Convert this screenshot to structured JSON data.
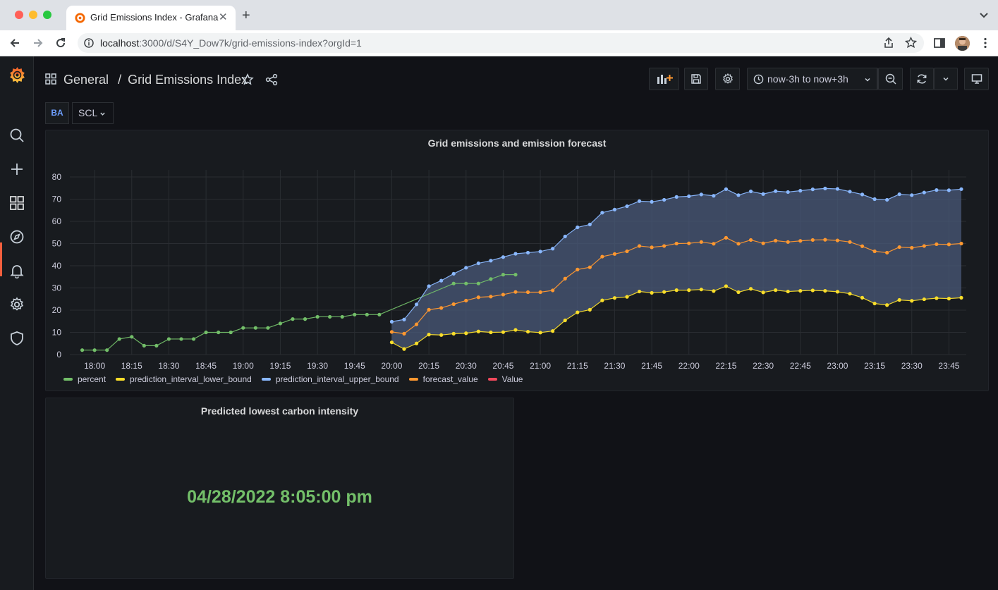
{
  "browser": {
    "tab_title": "Grid Emissions Index - Grafana",
    "url_host": "localhost",
    "url_path": ":3000/d/S4Y_Dow7k/grid-emissions-index?orgId=1"
  },
  "header": {
    "folder": "General",
    "separator": "/",
    "dashboard_title": "Grid Emissions Index",
    "time_range": "now-3h to now+3h"
  },
  "variables": {
    "label": "BA",
    "value": "SCL"
  },
  "panels": {
    "chart_title": "Grid emissions and emission forecast",
    "stat_title": "Predicted lowest carbon intensity",
    "stat_value": "04/28/2022 8:05:00 pm"
  },
  "chart_data": {
    "type": "line",
    "title": "Grid emissions and emission forecast",
    "ylim": [
      0,
      80
    ],
    "yticks": [
      0,
      10,
      20,
      30,
      40,
      50,
      60,
      70,
      80
    ],
    "xticks": [
      "18:00",
      "18:15",
      "18:30",
      "18:45",
      "19:00",
      "19:15",
      "19:30",
      "19:45",
      "20:00",
      "20:15",
      "20:30",
      "20:45",
      "21:00",
      "21:15",
      "21:30",
      "21:45",
      "22:00",
      "22:15",
      "22:30",
      "22:45",
      "23:00",
      "23:15",
      "23:30",
      "23:45"
    ],
    "grid": true,
    "legend_position": "bottom-left",
    "colors": {
      "percent": "#73bf69",
      "prediction_interval_lower_bound": "#fade2a",
      "prediction_interval_upper_bound": "#8ab8ff",
      "forecast_value": "#ff9830",
      "Value": "#f2495c",
      "band_fill": "#4a5a7a"
    },
    "series": [
      {
        "name": "percent",
        "x_start": "17:55",
        "step_min": 5,
        "values": [
          2,
          2,
          2,
          7,
          8,
          4,
          4,
          7,
          7,
          7,
          10,
          10,
          10,
          12,
          12,
          12,
          14,
          16,
          16,
          17,
          17,
          17,
          18,
          18,
          18,
          null,
          null,
          null,
          null,
          null,
          32,
          32,
          32,
          34,
          36,
          36
        ]
      },
      {
        "name": "prediction_interval_lower_bound",
        "x_start": "20:00",
        "step_min": 5,
        "values": [
          5.5,
          2.5,
          5,
          9,
          8.8,
          9.4,
          9.6,
          10.4,
          10,
          10.1,
          11.1,
          10.3,
          9.9,
          10.6,
          15.4,
          19,
          20.2,
          24.4,
          25.5,
          26,
          28.4,
          27.8,
          28.2,
          29,
          29,
          29.3,
          28.6,
          30.8,
          28.1,
          29.6,
          28,
          29,
          28.4,
          28.7,
          28.9,
          28.7,
          28.3,
          27.4,
          25.6,
          23,
          22.3,
          24.6,
          24.2,
          24.9,
          25.4,
          25.2,
          25.6
        ]
      },
      {
        "name": "prediction_interval_upper_bound",
        "x_start": "20:00",
        "step_min": 5,
        "values": [
          14.8,
          15.8,
          22.6,
          30.8,
          33.3,
          36.4,
          39.1,
          41.1,
          42.3,
          43.9,
          45.4,
          45.9,
          46.4,
          47.7,
          53.2,
          57.3,
          58.6,
          63.9,
          65.3,
          66.8,
          69.1,
          68.8,
          69.7,
          71,
          71.3,
          72.1,
          71.5,
          74.5,
          71.8,
          73.5,
          72.3,
          73.6,
          73.2,
          73.8,
          74.4,
          74.8,
          74.6,
          73.4,
          72.1,
          70,
          69.7,
          72.2,
          71.8,
          73,
          74.1,
          74,
          74.5
        ]
      },
      {
        "name": "forecast_value",
        "x_start": "20:00",
        "step_min": 5,
        "values": [
          10.2,
          9.4,
          13.6,
          20.2,
          21,
          22.7,
          24.3,
          25.8,
          26.1,
          27,
          28.2,
          28.1,
          28.1,
          28.9,
          34.2,
          38.3,
          39.3,
          44.1,
          45.3,
          46.5,
          48.9,
          48.3,
          48.9,
          50,
          50.1,
          50.7,
          49.9,
          52.6,
          49.9,
          51.6,
          50.1,
          51.3,
          50.7,
          51.2,
          51.6,
          51.7,
          51.4,
          50.7,
          48.8,
          46.5,
          45.9,
          48.4,
          48.1,
          48.9,
          49.7,
          49.6,
          50
        ]
      },
      {
        "name": "Value",
        "values": []
      }
    ]
  }
}
